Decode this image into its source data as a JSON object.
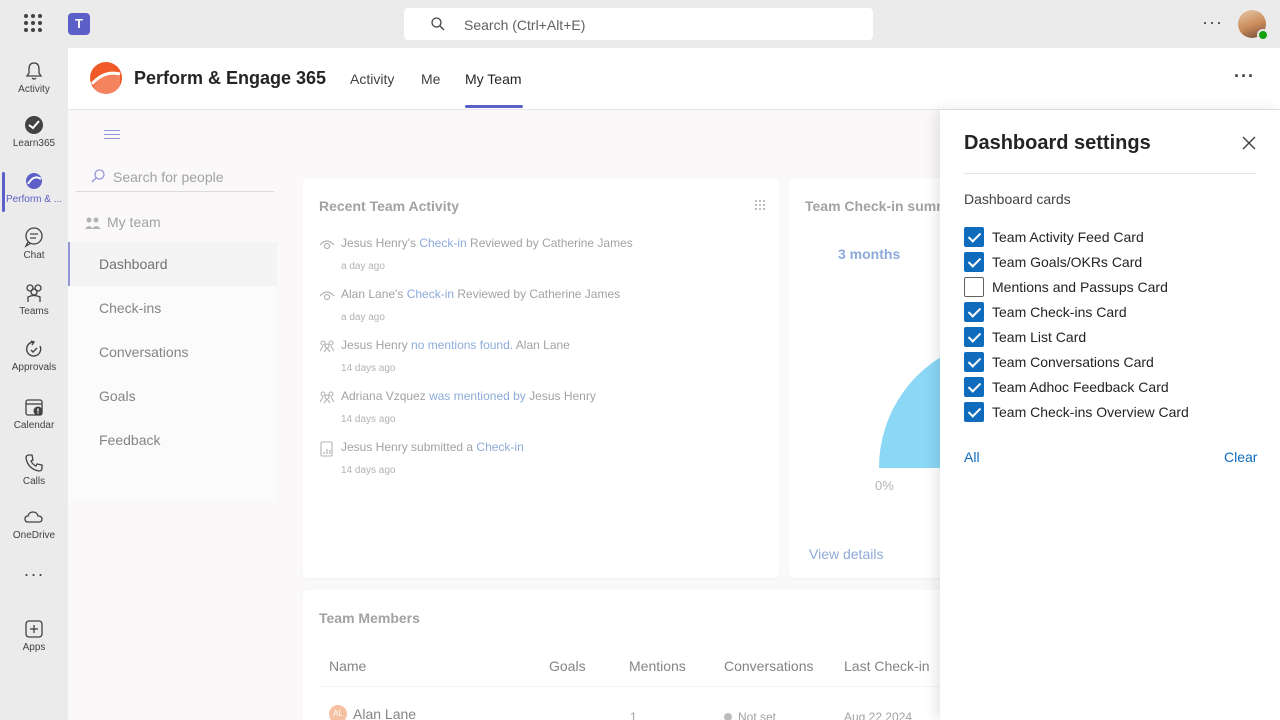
{
  "topbar": {
    "search_placeholder": "Search (Ctrl+Alt+E)"
  },
  "rail": {
    "items": [
      {
        "label": "Activity",
        "icon": "bell-icon"
      },
      {
        "label": "Learn365",
        "icon": "learn365-icon"
      },
      {
        "label": "Perform & ...",
        "icon": "perform-engage-icon",
        "active": true
      },
      {
        "label": "Chat",
        "icon": "chat-icon"
      },
      {
        "label": "Teams",
        "icon": "teams-icon"
      },
      {
        "label": "Approvals",
        "icon": "approvals-icon"
      },
      {
        "label": "Calendar",
        "icon": "calendar-icon"
      },
      {
        "label": "Calls",
        "icon": "phone-icon"
      },
      {
        "label": "OneDrive",
        "icon": "cloud-icon"
      },
      {
        "label": "",
        "icon": "more-apps-icon"
      },
      {
        "label": "Apps",
        "icon": "add-apps-icon"
      }
    ]
  },
  "app": {
    "name": "Perform & Engage 365",
    "tabs": [
      {
        "label": "Activity"
      },
      {
        "label": "Me"
      },
      {
        "label": "My Team",
        "active": true
      }
    ]
  },
  "left_panel": {
    "search_placeholder": "Search for people",
    "section": "My team",
    "nav": [
      {
        "label": "Dashboard",
        "active": true
      },
      {
        "label": "Check-ins"
      },
      {
        "label": "Conversations"
      },
      {
        "label": "Goals"
      },
      {
        "label": "Feedback"
      }
    ]
  },
  "recent_activity": {
    "title": "Recent Team Activity",
    "items": [
      {
        "icon": "eye-icon",
        "p1": "Jesus Henry's",
        "link": "Check-in",
        "p2": "Reviewed by Catherine James",
        "time": "a day ago"
      },
      {
        "icon": "eye-icon",
        "p1": "Alan Lane's",
        "link": "Check-in",
        "p2": "Reviewed by Catherine James",
        "time": "a day ago"
      },
      {
        "icon": "people-icon",
        "p1": "Jesus Henry",
        "link": "no mentions found.",
        "p2": "Alan Lane",
        "time": "14 days ago"
      },
      {
        "icon": "people-icon",
        "p1": "Adriana Vzquez",
        "link": "was mentioned by",
        "p2": "Jesus Henry",
        "time": "14 days ago"
      },
      {
        "icon": "document-icon",
        "p1": "Jesus Henry submitted a",
        "link": "Check-in",
        "p2": "",
        "time": "14 days ago"
      }
    ]
  },
  "checkin_summary": {
    "title": "Team Check-in summ",
    "period": "3 months",
    "pct_label": "0%",
    "view_details": "View details",
    "chart_color": "#4cc2f1"
  },
  "team_members": {
    "title": "Team Members",
    "columns": [
      "Name",
      "Goals",
      "Mentions",
      "Conversations",
      "Last Check-in"
    ],
    "rows": [
      {
        "initials": "AL",
        "name": "Alan Lane",
        "mentions": "1",
        "conversations": "Not set",
        "last_checkin": "Aug 22 2024"
      }
    ]
  },
  "settings": {
    "title": "Dashboard settings",
    "section": "Dashboard cards",
    "cards": [
      {
        "label": "Team Activity Feed Card",
        "checked": true
      },
      {
        "label": "Team Goals/OKRs Card",
        "checked": true
      },
      {
        "label": "Mentions and Passups Card",
        "checked": false
      },
      {
        "label": "Team Check-ins Card",
        "checked": true
      },
      {
        "label": "Team List Card",
        "checked": true
      },
      {
        "label": "Team Conversations Card",
        "checked": true
      },
      {
        "label": "Team Adhoc Feedback Card",
        "checked": true
      },
      {
        "label": "Team Check-ins Overview Card",
        "checked": true
      }
    ],
    "all_label": "All",
    "clear_label": "Clear",
    "accent": "#0f6cbd"
  },
  "colors": {
    "brand": "#5b5fc7",
    "app_logo": "#f05a28",
    "link": "#4f7dc6"
  }
}
